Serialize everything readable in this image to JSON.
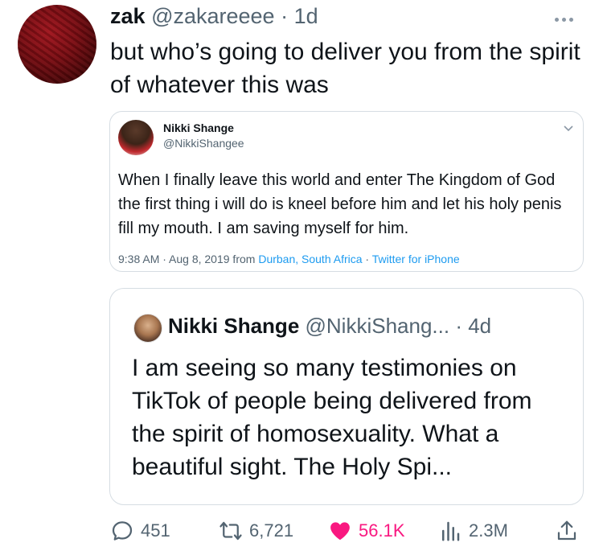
{
  "tweet": {
    "author_name": "zak",
    "handle": "@zakareeee",
    "time": "1d",
    "text": "but who’s going to deliver you from the spirit of whatever this was"
  },
  "embedded_tweet": {
    "author_name": "Nikki Shange",
    "handle": "@NikkiShangee",
    "text": "When I finally leave this world and enter The Kingdom of God the first thing i will do is kneel before him and let his holy penis fill my mouth. I am saving myself for him.",
    "time": "9:38 AM · Aug 8, 2019 from ",
    "location": "Durban, South Africa",
    "separator": " · ",
    "client": "Twitter for iPhone"
  },
  "quoted_tweet": {
    "author_name": "Nikki Shange",
    "handle": "@NikkiShang...",
    "time": "4d",
    "text": "I am seeing so many testimonies on TikTok of people being delivered from the spirit of homosexuality. What a beautiful sight. The Holy Spi..."
  },
  "actions": {
    "replies": "451",
    "retweets": "6,721",
    "likes": "56.1K",
    "views": "2.3M"
  },
  "colors": {
    "like": "#f91880",
    "link": "#1d9bf0",
    "muted": "#536471"
  },
  "icons": [
    "more-icon",
    "chevron-down-icon",
    "reply-icon",
    "retweet-icon",
    "heart-icon",
    "views-icon",
    "share-icon"
  ]
}
